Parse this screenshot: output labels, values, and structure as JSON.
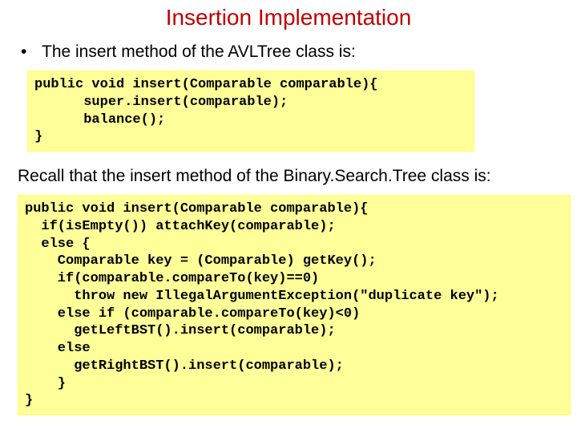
{
  "title": "Insertion Implementation",
  "bullet1": "The insert method of the AVLTree class is:",
  "code1": "public void insert(Comparable comparable){\n      super.insert(comparable);\n      balance();\n}",
  "paragraph": "Recall that the insert method of the Binary.Search.Tree class is:",
  "code2": "public void insert(Comparable comparable){\n  if(isEmpty()) attachKey(comparable);\n  else {\n    Comparable key = (Comparable) getKey();\n    if(comparable.compareTo(key)==0)\n      throw new IllegalArgumentException(\"duplicate key\");\n    else if (comparable.compareTo(key)<0)\n      getLeftBST().insert(comparable);\n    else\n      getRightBST().insert(comparable);\n    }\n}"
}
